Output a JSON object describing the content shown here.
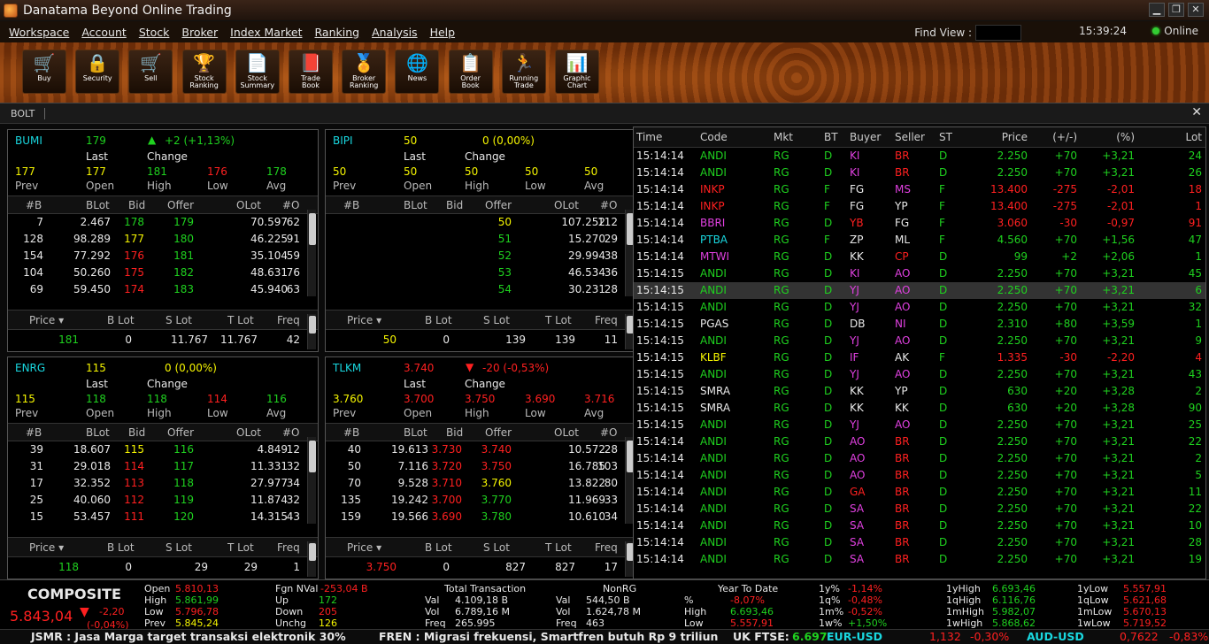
{
  "window": {
    "title": "Danatama Beyond Online Trading"
  },
  "menu": [
    "Workspace",
    "Account",
    "Stock",
    "Broker",
    "Index Market",
    "Ranking",
    "Analysis",
    "Help"
  ],
  "status": {
    "find_label": "Find View :",
    "time": "15:39:24",
    "online": "Online"
  },
  "toolbar": [
    {
      "label1": "Buy",
      "label2": "",
      "icon": "cart-in-icon"
    },
    {
      "label1": "Security",
      "label2": "",
      "icon": "lock-icon"
    },
    {
      "label1": "Sell",
      "label2": "",
      "icon": "cart-out-icon"
    },
    {
      "label1": "Stock",
      "label2": "Ranking",
      "icon": "trophy-icon"
    },
    {
      "label1": "Stock",
      "label2": "Summary",
      "icon": "document-icon"
    },
    {
      "label1": "Trade",
      "label2": "Book",
      "icon": "book-icon"
    },
    {
      "label1": "Broker",
      "label2": "Ranking",
      "icon": "medal-icon"
    },
    {
      "label1": "News",
      "label2": "",
      "icon": "globe-icon"
    },
    {
      "label1": "Order",
      "label2": "Book",
      "icon": "orderbook-icon"
    },
    {
      "label1": "Running",
      "label2": "Trade",
      "icon": "runner-icon"
    },
    {
      "label1": "Graphic",
      "label2": "Chart",
      "icon": "barchart-icon"
    }
  ],
  "tab": {
    "label": "BOLT",
    "close": "✕"
  },
  "labels": {
    "last": "Last",
    "change": "Change",
    "prev": "Prev",
    "open": "Open",
    "high": "High",
    "low": "Low",
    "avg": "Avg",
    "ob_headers": [
      "#B",
      "BLot",
      "Bid",
      "Offer",
      "OLot",
      "#O"
    ],
    "sum_headers": [
      "Price ▾",
      "B Lot",
      "S Lot",
      "T Lot",
      "Freq"
    ]
  },
  "panels": [
    {
      "code": "BUMI",
      "last": "179",
      "arrow": "▲",
      "change": "+2 (+1,13%)",
      "prev": "177",
      "open": "177",
      "high": "181",
      "low": "176",
      "avg": "178",
      "colors": {
        "last": "g",
        "change": "g",
        "open": "y",
        "high": "g",
        "low": "r",
        "avg": "g"
      },
      "rows": [
        [
          "7",
          "2.467",
          "178",
          "179",
          "70.597",
          "62"
        ],
        [
          "128",
          "98.289",
          "177",
          "180",
          "46.225",
          "91"
        ],
        [
          "154",
          "77.292",
          "176",
          "181",
          "35.104",
          "59"
        ],
        [
          "104",
          "50.260",
          "175",
          "182",
          "48.631",
          "76"
        ],
        [
          "69",
          "59.450",
          "174",
          "183",
          "45.940",
          "63"
        ]
      ],
      "bidc": [
        "g",
        "y",
        "r",
        "r",
        "r"
      ],
      "offc": [
        "g",
        "g",
        "g",
        "g",
        "g"
      ],
      "sum": {
        "price": "181",
        "blot": "0",
        "slot": "11.767",
        "tlot": "11.767",
        "freq": "42"
      },
      "sumc": "g"
    },
    {
      "code": "BIPI",
      "last": "50",
      "arrow": "",
      "change": "0 (0,00%)",
      "prev": "50",
      "open": "50",
      "high": "50",
      "low": "50",
      "avg": "50",
      "colors": {
        "last": "y",
        "change": "y",
        "open": "y",
        "high": "y",
        "low": "y",
        "avg": "y"
      },
      "rows": [
        [
          "",
          "",
          "",
          "50",
          "107.252",
          "112"
        ],
        [
          "",
          "",
          "",
          "51",
          "15.270",
          "29"
        ],
        [
          "",
          "",
          "",
          "52",
          "29.994",
          "38"
        ],
        [
          "",
          "",
          "",
          "53",
          "46.534",
          "36"
        ],
        [
          "",
          "",
          "",
          "54",
          "30.231",
          "28"
        ]
      ],
      "bidc": [
        "w",
        "w",
        "w",
        "w",
        "w"
      ],
      "offc": [
        "y",
        "g",
        "g",
        "g",
        "g"
      ],
      "sum": {
        "price": "50",
        "blot": "0",
        "slot": "139",
        "tlot": "139",
        "freq": "11"
      },
      "sumc": "y"
    },
    {
      "code": "ENRG",
      "last": "115",
      "arrow": "",
      "change": "0 (0,00%)",
      "prev": "115",
      "open": "118",
      "high": "118",
      "low": "114",
      "avg": "116",
      "colors": {
        "last": "y",
        "change": "y",
        "open": "g",
        "high": "g",
        "low": "r",
        "avg": "g"
      },
      "rows": [
        [
          "39",
          "18.607",
          "115",
          "116",
          "4.849",
          "12"
        ],
        [
          "31",
          "29.018",
          "114",
          "117",
          "11.331",
          "32"
        ],
        [
          "17",
          "32.352",
          "113",
          "118",
          "27.977",
          "34"
        ],
        [
          "25",
          "40.060",
          "112",
          "119",
          "11.874",
          "32"
        ],
        [
          "15",
          "53.457",
          "111",
          "120",
          "14.315",
          "43"
        ]
      ],
      "bidc": [
        "y",
        "r",
        "r",
        "r",
        "r"
      ],
      "offc": [
        "g",
        "g",
        "g",
        "g",
        "g"
      ],
      "sum": {
        "price": "118",
        "blot": "0",
        "slot": "29",
        "tlot": "29",
        "freq": "1"
      },
      "sumc": "g"
    },
    {
      "code": "TLKM",
      "last": "3.740",
      "arrow": "▼",
      "change": "-20 (-0,53%)",
      "prev": "3.760",
      "open": "3.700",
      "high": "3.750",
      "low": "3.690",
      "avg": "3.716",
      "colors": {
        "last": "r",
        "change": "r",
        "open": "r",
        "high": "r",
        "low": "r",
        "avg": "r"
      },
      "rows": [
        [
          "40",
          "19.613",
          "3.730",
          "3.740",
          "10.572",
          "28"
        ],
        [
          "50",
          "7.116",
          "3.720",
          "3.750",
          "16.785",
          "103"
        ],
        [
          "70",
          "9.528",
          "3.710",
          "3.760",
          "13.822",
          "80"
        ],
        [
          "135",
          "19.242",
          "3.700",
          "3.770",
          "11.969",
          "33"
        ],
        [
          "159",
          "19.566",
          "3.690",
          "3.780",
          "10.610",
          "34"
        ]
      ],
      "bidc": [
        "r",
        "r",
        "r",
        "r",
        "r"
      ],
      "offc": [
        "r",
        "r",
        "y",
        "g",
        "g"
      ],
      "sum": {
        "price": "3.750",
        "blot": "0",
        "slot": "827",
        "tlot": "827",
        "freq": "17"
      },
      "sumc": "r"
    }
  ],
  "trade_headers": [
    "Time",
    "Code",
    "Mkt",
    "BT",
    "Buyer",
    "Seller",
    "ST",
    "Price",
    "(+/-)",
    "(%)",
    "Lot"
  ],
  "trades": [
    [
      "15:14:14",
      "ANDI",
      "RG",
      "D",
      "KI",
      "BR",
      "D",
      "2.250",
      "+70",
      "+3,21",
      "24",
      "g",
      "m",
      "r",
      "g"
    ],
    [
      "15:14:14",
      "ANDI",
      "RG",
      "D",
      "KI",
      "BR",
      "D",
      "2.250",
      "+70",
      "+3,21",
      "26",
      "g",
      "m",
      "r",
      "g"
    ],
    [
      "15:14:14",
      "INKP",
      "RG",
      "F",
      "FG",
      "MS",
      "F",
      "13.400",
      "-275",
      "-2,01",
      "18",
      "r",
      "w",
      "m",
      "r"
    ],
    [
      "15:14:14",
      "INKP",
      "RG",
      "F",
      "FG",
      "YP",
      "F",
      "13.400",
      "-275",
      "-2,01",
      "1",
      "r",
      "w",
      "w",
      "r"
    ],
    [
      "15:14:14",
      "BBRI",
      "RG",
      "D",
      "YB",
      "FG",
      "F",
      "3.060",
      "-30",
      "-0,97",
      "91",
      "m",
      "r",
      "w",
      "r"
    ],
    [
      "15:14:14",
      "PTBA",
      "RG",
      "F",
      "ZP",
      "ML",
      "F",
      "4.560",
      "+70",
      "+1,56",
      "47",
      "cy",
      "w",
      "w",
      "g"
    ],
    [
      "15:14:14",
      "MTWI",
      "RG",
      "D",
      "KK",
      "CP",
      "D",
      "99",
      "+2",
      "+2,06",
      "1",
      "m",
      "w",
      "r",
      "g"
    ],
    [
      "15:14:15",
      "ANDI",
      "RG",
      "D",
      "KI",
      "AO",
      "D",
      "2.250",
      "+70",
      "+3,21",
      "45",
      "g",
      "m",
      "m",
      "g"
    ],
    [
      "15:14:15",
      "ANDI",
      "RG",
      "D",
      "YJ",
      "AO",
      "D",
      "2.250",
      "+70",
      "+3,21",
      "6",
      "g",
      "m",
      "m",
      "g"
    ],
    [
      "15:14:15",
      "ANDI",
      "RG",
      "D",
      "YJ",
      "AO",
      "D",
      "2.250",
      "+70",
      "+3,21",
      "32",
      "g",
      "m",
      "m",
      "g"
    ],
    [
      "15:14:15",
      "PGAS",
      "RG",
      "D",
      "DB",
      "NI",
      "D",
      "2.310",
      "+80",
      "+3,59",
      "1",
      "w",
      "w",
      "m",
      "g"
    ],
    [
      "15:14:15",
      "ANDI",
      "RG",
      "D",
      "YJ",
      "AO",
      "D",
      "2.250",
      "+70",
      "+3,21",
      "9",
      "g",
      "m",
      "m",
      "g"
    ],
    [
      "15:14:15",
      "KLBF",
      "RG",
      "D",
      "IF",
      "AK",
      "F",
      "1.335",
      "-30",
      "-2,20",
      "4",
      "y",
      "m",
      "w",
      "r"
    ],
    [
      "15:14:15",
      "ANDI",
      "RG",
      "D",
      "YJ",
      "AO",
      "D",
      "2.250",
      "+70",
      "+3,21",
      "43",
      "g",
      "m",
      "m",
      "g"
    ],
    [
      "15:14:15",
      "SMRA",
      "RG",
      "D",
      "KK",
      "YP",
      "D",
      "630",
      "+20",
      "+3,28",
      "2",
      "w",
      "w",
      "w",
      "g"
    ],
    [
      "15:14:15",
      "SMRA",
      "RG",
      "D",
      "KK",
      "KK",
      "D",
      "630",
      "+20",
      "+3,28",
      "90",
      "w",
      "w",
      "w",
      "g"
    ],
    [
      "15:14:15",
      "ANDI",
      "RG",
      "D",
      "YJ",
      "AO",
      "D",
      "2.250",
      "+70",
      "+3,21",
      "25",
      "g",
      "m",
      "m",
      "g"
    ],
    [
      "15:14:14",
      "ANDI",
      "RG",
      "D",
      "AO",
      "BR",
      "D",
      "2.250",
      "+70",
      "+3,21",
      "22",
      "g",
      "m",
      "r",
      "g"
    ],
    [
      "15:14:14",
      "ANDI",
      "RG",
      "D",
      "AO",
      "BR",
      "D",
      "2.250",
      "+70",
      "+3,21",
      "2",
      "g",
      "m",
      "r",
      "g"
    ],
    [
      "15:14:14",
      "ANDI",
      "RG",
      "D",
      "AO",
      "BR",
      "D",
      "2.250",
      "+70",
      "+3,21",
      "5",
      "g",
      "m",
      "r",
      "g"
    ],
    [
      "15:14:14",
      "ANDI",
      "RG",
      "D",
      "GA",
      "BR",
      "D",
      "2.250",
      "+70",
      "+3,21",
      "11",
      "g",
      "r",
      "r",
      "g"
    ],
    [
      "15:14:14",
      "ANDI",
      "RG",
      "D",
      "SA",
      "BR",
      "D",
      "2.250",
      "+70",
      "+3,21",
      "22",
      "g",
      "m",
      "r",
      "g"
    ],
    [
      "15:14:14",
      "ANDI",
      "RG",
      "D",
      "SA",
      "BR",
      "D",
      "2.250",
      "+70",
      "+3,21",
      "10",
      "g",
      "m",
      "r",
      "g"
    ],
    [
      "15:14:14",
      "ANDI",
      "RG",
      "D",
      "SA",
      "BR",
      "D",
      "2.250",
      "+70",
      "+3,21",
      "28",
      "g",
      "m",
      "r",
      "g"
    ],
    [
      "15:14:14",
      "ANDI",
      "RG",
      "D",
      "SA",
      "BR",
      "D",
      "2.250",
      "+70",
      "+3,21",
      "19",
      "g",
      "m",
      "r",
      "g"
    ]
  ],
  "composite": {
    "name": "COMPOSITE",
    "value": "5.843,04",
    "arrow": "▼",
    "change": "-2,20",
    "pct": "(-0,04%)",
    "open": "5.810,13",
    "high": "5.861,99",
    "low": "5.796,78",
    "prev": "5.845,24"
  },
  "market": {
    "fgn": "Fgn NVal",
    "fgn_v": "-253,04 B",
    "up": "172",
    "down": "205",
    "unchg": "126",
    "tt": "Total Transaction",
    "t_val": "4.109,18 B",
    "t_vol": "6.789,16 M",
    "t_freq": "265.995",
    "nonrg": "NonRG",
    "n_val": "544,50 B",
    "n_vol": "1.624,78 M",
    "n_freq": "463",
    "ytd": "Year To Date",
    "ytd_pct": "-8,07%",
    "ytd_high": "6.693,46",
    "ytd_low": "5.557,91",
    "p1y": "-1,14%",
    "p1q": "-0,48%",
    "p1m": "-0,52%",
    "p1w": "+1,50%",
    "h1y": "6.693,46",
    "h1q": "6.116,76",
    "h1m": "5.982,07",
    "h1w": "5.868,62",
    "l1y": "5.557,91",
    "l1q": "5.621,68",
    "l1m": "5.670,13",
    "l1w": "5.719,52"
  },
  "ticker": {
    "news1": "JSMR : Jasa Marga target transaksi elektronik 30%",
    "news2": "FREN : Migrasi frekuensi, Smartfren butuh Rp 9 triliun",
    "ftse_label": "UK FTSE:",
    "ftse": "6.697",
    "eur": "EUR-USD",
    "eur_v": "1,132",
    "eur_p": "-0,30%",
    "aud": "AUD-USD",
    "aud_v": "0,7622",
    "aud_p": "-0,83%"
  }
}
